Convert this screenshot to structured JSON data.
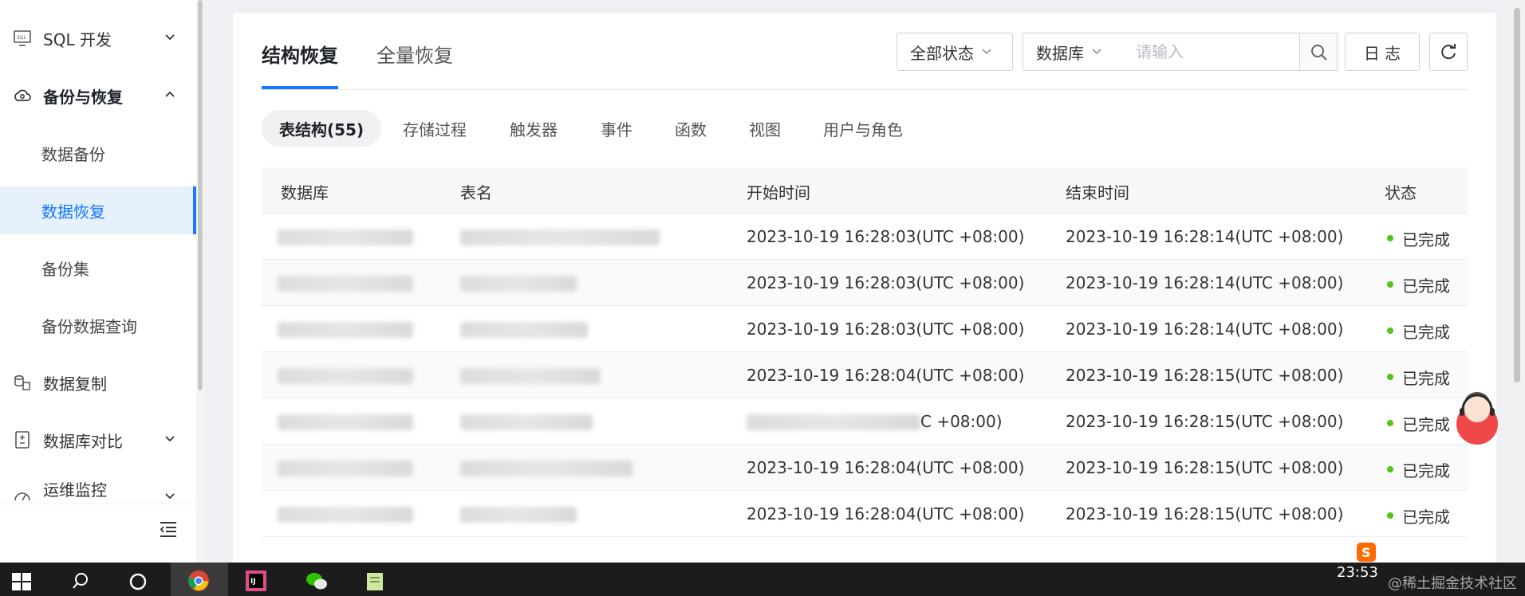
{
  "sidebar": {
    "items": [
      {
        "label": "SQL 开发",
        "icon": "sql-terminal-icon",
        "expanded": false
      },
      {
        "label": "备份与恢复",
        "icon": "cloud-backup-icon",
        "expanded": true
      },
      {
        "label": "数据备份"
      },
      {
        "label": "数据恢复",
        "active": true
      },
      {
        "label": "备份集"
      },
      {
        "label": "备份数据查询"
      },
      {
        "label": "数据复制",
        "icon": "data-copy-icon"
      },
      {
        "label": "数据库对比",
        "icon": "compare-doc-icon",
        "expanded": false
      },
      {
        "label": "运维监控",
        "icon": "monitor-icon",
        "expanded": false
      }
    ]
  },
  "header": {
    "tabs": [
      {
        "label": "结构恢复",
        "active": true
      },
      {
        "label": "全量恢复",
        "active": false
      }
    ],
    "status_filter": "全部状态",
    "db_filter": "数据库",
    "search_placeholder": "请输入",
    "log_button": "日 志"
  },
  "sub_tabs": [
    {
      "label": "表结构(55)",
      "active": true
    },
    {
      "label": "存储过程"
    },
    {
      "label": "触发器"
    },
    {
      "label": "事件"
    },
    {
      "label": "函数"
    },
    {
      "label": "视图"
    },
    {
      "label": "用户与角色"
    }
  ],
  "table": {
    "columns": [
      "数据库",
      "表名",
      "开始时间",
      "结束时间",
      "状态"
    ],
    "rows": [
      {
        "start": "2023-10-19 16:28:03(UTC +08:00)",
        "end": "2023-10-19 16:28:14(UTC +08:00)",
        "status": "已完成"
      },
      {
        "start": "2023-10-19 16:28:03(UTC +08:00)",
        "end": "2023-10-19 16:28:14(UTC +08:00)",
        "status": "已完成"
      },
      {
        "start": "2023-10-19 16:28:03(UTC +08:00)",
        "end": "2023-10-19 16:28:14(UTC +08:00)",
        "status": "已完成"
      },
      {
        "start": "2023-10-19 16:28:04(UTC +08:00)",
        "end": "2023-10-19 16:28:15(UTC +08:00)",
        "status": "已完成"
      },
      {
        "start": "C +08:00)",
        "end": "2023-10-19 16:28:15(UTC +08:00)",
        "status": "已完成"
      },
      {
        "start": "2023-10-19 16:28:04(UTC +08:00)",
        "end": "2023-10-19 16:28:15(UTC +08:00)",
        "status": "已完成"
      },
      {
        "start": "2023-10-19 16:28:04(UTC +08:00)",
        "end": "2023-10-19 16:28:15(UTC +08:00)",
        "status": "已完成"
      }
    ],
    "status_color": "#52c41a"
  },
  "taskbar": {
    "clock": "23:53",
    "watermark": "@稀土掘金技术社区"
  },
  "colors": {
    "accent": "#1677ff",
    "active_bg": "#e6f1fc",
    "success": "#52c41a"
  }
}
